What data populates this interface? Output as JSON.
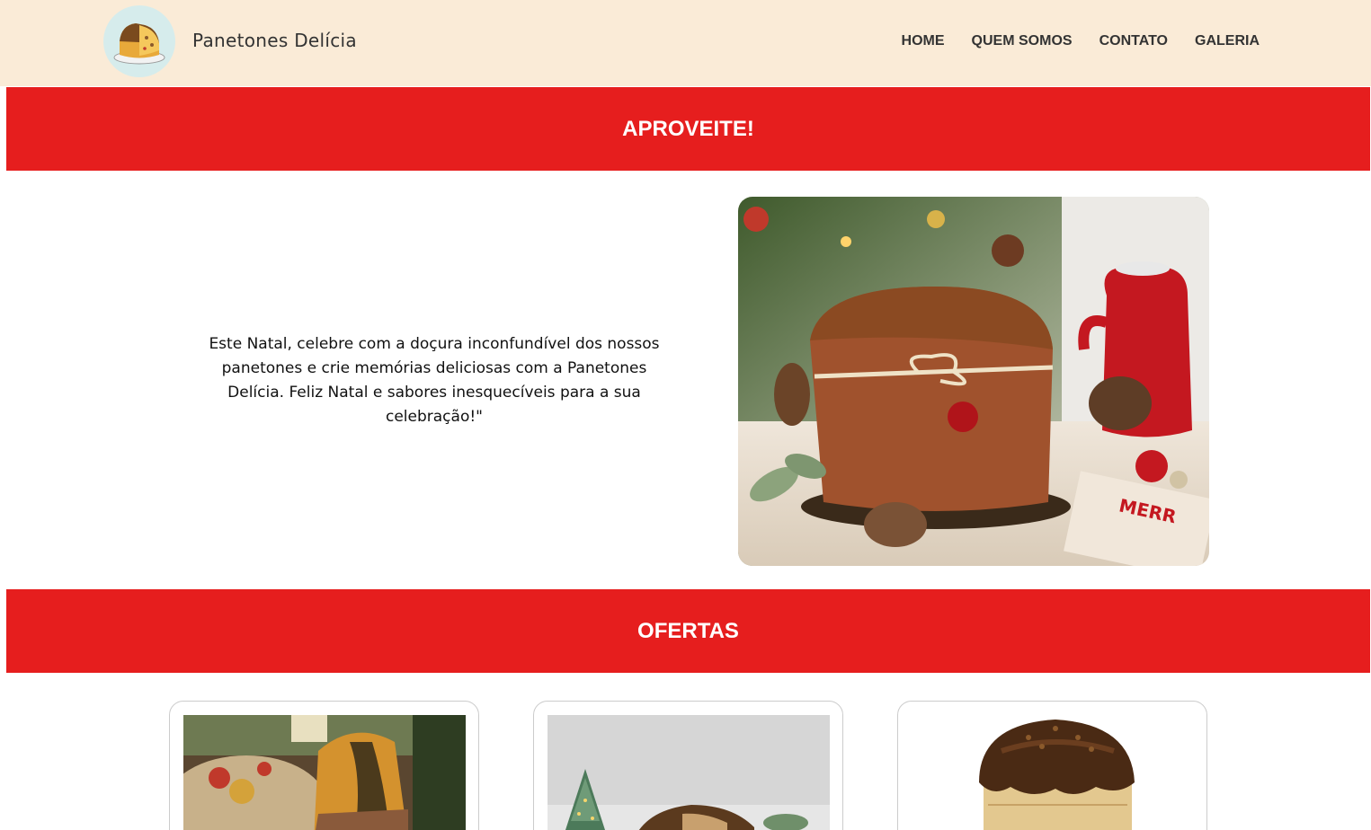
{
  "header": {
    "brand": "Panetones Delícia",
    "logo_icon": "panettone-logo-icon",
    "background": "#faebd7",
    "nav": [
      "HOME",
      "QUEM SOMOS",
      "CONTATO",
      "GALERIA"
    ]
  },
  "promo": {
    "banner_title": "APROVEITE!",
    "text": "Este Natal, celebre com a doçura inconfundível dos nossos panetones e crie memórias deliciosas com a Panetones Delícia. Feliz Natal e sabores inesquecíveis para a sua celebração!\"",
    "image": "panettone-christmas-photo"
  },
  "offers": {
    "banner_title": "OFERTAS",
    "cards": [
      {
        "image": "marble-panettone-photo"
      },
      {
        "image": "panettone-with-tree-photo"
      },
      {
        "image": "chocolate-panettone-photo"
      }
    ]
  },
  "colors": {
    "accent_red": "#e61e1e",
    "header_bg": "#faebd7"
  }
}
